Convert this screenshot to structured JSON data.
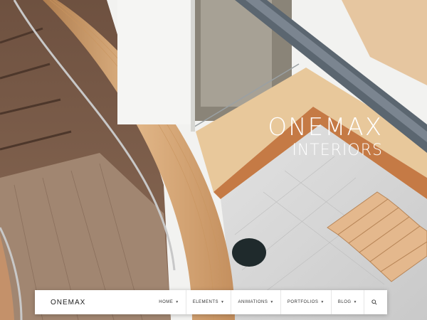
{
  "hero": {
    "title": "ONEMAX",
    "subtitle": "INTERIORS"
  },
  "header": {
    "logo": "ONEMAX",
    "menu": [
      {
        "label": "HOME"
      },
      {
        "label": "ELEMENTS"
      },
      {
        "label": "ANIMATIONS"
      },
      {
        "label": "PORTFOLIOS"
      },
      {
        "label": "BLOG"
      }
    ],
    "search_icon": "search-icon",
    "chevron_icon": "chevron-down-icon"
  },
  "colors": {
    "wood": "#d9a877",
    "wood_dark": "#9b6a3e",
    "floor": "#d8d8d8",
    "navbar_bg": "#ffffff",
    "hero_text": "#ffffff"
  }
}
